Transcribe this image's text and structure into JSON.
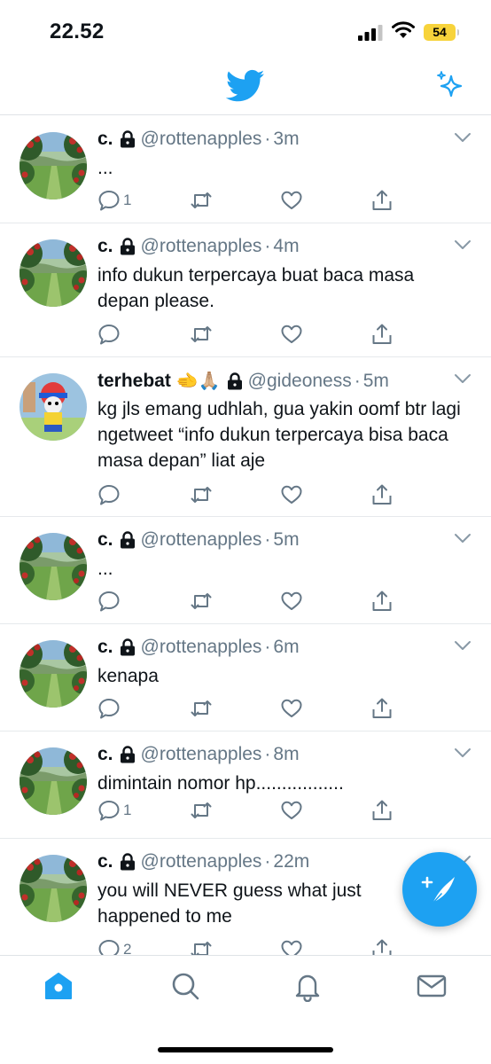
{
  "status_bar": {
    "time": "22.52",
    "battery_level": "54",
    "battery_color": "#f7d33b"
  },
  "theme": {
    "accent": "#1da1f2",
    "text": "#0f1419",
    "muted": "#657786",
    "divider": "#e6e9ec"
  },
  "header": {
    "logo_icon": "twitter-bird-icon",
    "right_icon": "sparkle-icon"
  },
  "tweets": [
    {
      "name": "c.",
      "emoji": "",
      "protected": true,
      "handle": "@rottenapples",
      "time": "3m",
      "text": "...",
      "reply_count": "1",
      "avatar": "apple-tree-avatar"
    },
    {
      "name": "c.",
      "emoji": "",
      "protected": true,
      "handle": "@rottenapples",
      "time": "4m",
      "text": "info dukun terpercaya buat baca masa depan please.",
      "reply_count": "",
      "avatar": "apple-tree-avatar"
    },
    {
      "name": "terhebat",
      "emoji": "🫲🙏🏼",
      "protected": true,
      "handle": "@gideoness",
      "time": "5m",
      "text": "kg jls emang udhlah, gua yakin oomf btr lagi ngetweet “info dukun terpercaya bisa baca masa depan” liat aje",
      "reply_count": "",
      "avatar": "cartoon-character-avatar"
    },
    {
      "name": "c.",
      "emoji": "",
      "protected": true,
      "handle": "@rottenapples",
      "time": "5m",
      "text": "...",
      "reply_count": "",
      "avatar": "apple-tree-avatar"
    },
    {
      "name": "c.",
      "emoji": "",
      "protected": true,
      "handle": "@rottenapples",
      "time": "6m",
      "text": "kenapa",
      "reply_count": "",
      "avatar": "apple-tree-avatar"
    },
    {
      "name": "c.",
      "emoji": "",
      "protected": true,
      "handle": "@rottenapples",
      "time": "8m",
      "text": "dimintain nomor hp.................",
      "reply_count": "1",
      "avatar": "apple-tree-avatar"
    },
    {
      "name": "c.",
      "emoji": "",
      "protected": true,
      "handle": "@rottenapples",
      "time": "22m",
      "text": "you will NEVER guess what just happened to me",
      "reply_count": "2",
      "avatar": "apple-tree-avatar"
    }
  ],
  "tabbar": {
    "tabs": [
      "home",
      "search",
      "notifications",
      "messages"
    ],
    "active": "home"
  }
}
